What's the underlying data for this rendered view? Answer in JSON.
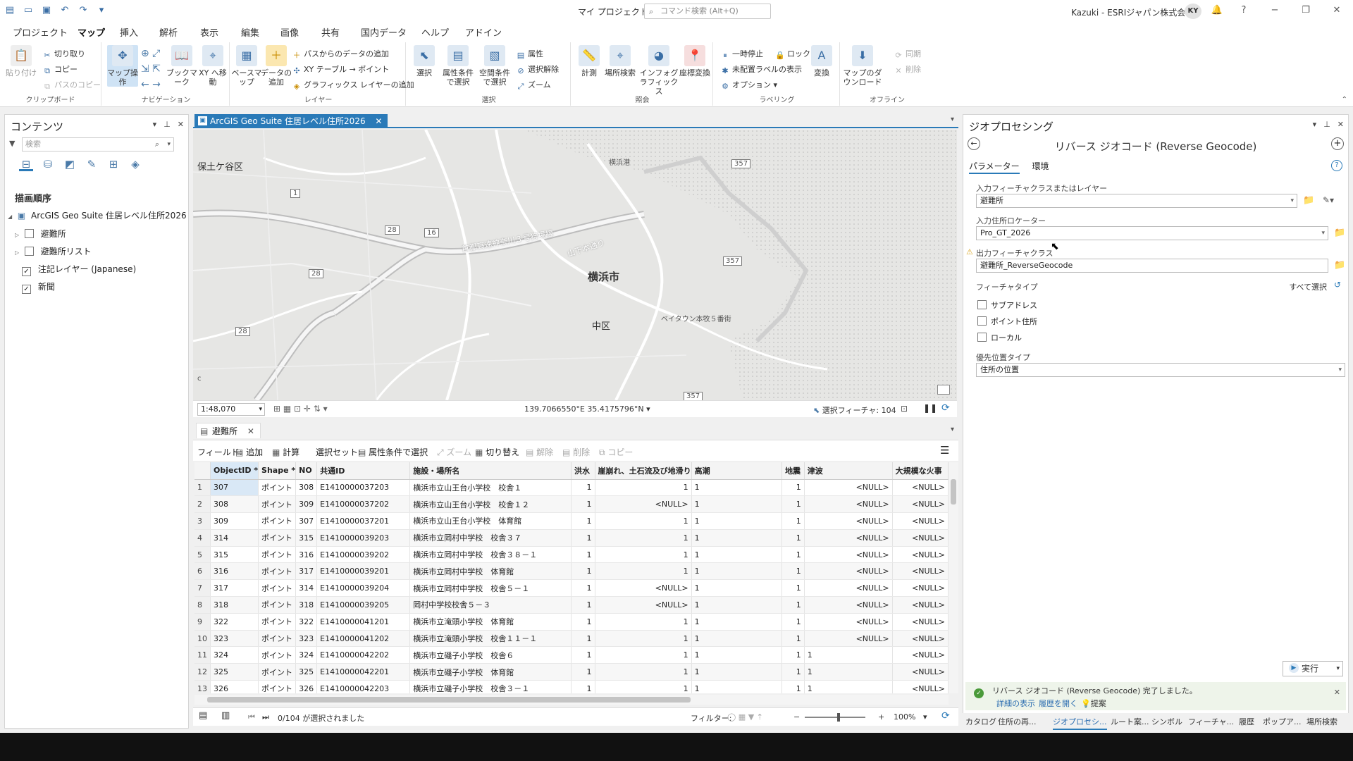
{
  "window": {
    "title": "マイ プロジェクト2",
    "command_search_placeholder": "コマンド検索 (Alt+Q)",
    "user": "Kazuki - ESRIジャパン株式会社",
    "avatar": "KY"
  },
  "ribbon_tabs": [
    "プロジェクト",
    "マップ",
    "挿入",
    "解析",
    "表示",
    "編集",
    "画像",
    "共有",
    "国内データ",
    "ヘルプ",
    "アドイン"
  ],
  "ribbon": {
    "clipboard": {
      "label": "クリップボード",
      "paste": "貼り付け",
      "cut": "切り取り",
      "copy": "コピー",
      "copy_path": "パスのコピー"
    },
    "navigation": {
      "label": "ナビゲーション",
      "explore": "マップ操作",
      "bookmarks": "ブックマーク",
      "xy": "XY へ移動"
    },
    "layer": {
      "label": "レイヤー",
      "basemap": "ベースマップ",
      "add_data": "データの追加",
      "add_from_path": "パスからのデータの追加",
      "xy_table": "XY テーブル → ポイント",
      "add_graphics": "グラフィックス レイヤーの追加"
    },
    "selection": {
      "label": "選択",
      "select": "選択",
      "by_attr": "属性条件で選択",
      "by_location": "空間条件で選択",
      "attributes": "属性",
      "clear": "選択解除",
      "zoom": "ズーム"
    },
    "inquiry": {
      "label": "照会",
      "measure": "計測",
      "locate": "場所検索",
      "infographics": "インフォグラフィックス",
      "convert_coords": "座標変換"
    },
    "labeling": {
      "label": "ラベリング",
      "pause": "一時停止",
      "lock": "ロック",
      "unplaced": "未配置ラベルの表示",
      "options": "オプション",
      "convert": "変換"
    },
    "offline": {
      "label": "オフライン",
      "download": "マップのダウンロード",
      "sync": "同期",
      "remove": "削除"
    }
  },
  "contents": {
    "title": "コンテンツ",
    "search_placeholder": "検索",
    "drawing_order": "描画順序",
    "map_name": "ArcGIS Geo Suite 住居レベル住所2026",
    "layers": [
      {
        "name": "避難所",
        "checked": false
      },
      {
        "name": "避難所リスト",
        "checked": false
      },
      {
        "name": "注記レイヤー (Japanese)",
        "checked": true
      },
      {
        "name": "新聞",
        "checked": true
      }
    ]
  },
  "map_view": {
    "tab_title": "ArcGIS Geo Suite 住居レベル住所2026",
    "labels": {
      "hodogaya": "保土ケ谷区",
      "yokohama_city": "横浜市",
      "naka": "中区",
      "baytown": "ベイタウン本牧５番街",
      "yamashita": "山下本通り",
      "expressway": "首都高速神奈川３号狩場線",
      "yokohama_port": "横浜港",
      "route_1": "1",
      "route_16": "16",
      "route_28a": "28",
      "route_28b": "28",
      "route_28c": "28",
      "route_357a": "357",
      "route_357b": "357",
      "route_357c": "357",
      "corner": "c"
    },
    "scale": "1:48,070",
    "coordinates": "139.7066550°E 35.4175796°N",
    "selected_features": "選択フィーチャ: 104"
  },
  "attribute_table": {
    "tab_title": "避難所",
    "toolbar": {
      "field": "フィールド:",
      "add": "追加",
      "calculate": "計算",
      "selection_set": "選択セット:",
      "select_by_attr": "属性条件で選択",
      "zoom": "ズーム",
      "switch": "切り替え",
      "clear": "解除",
      "delete": "削除",
      "copy": "コピー"
    },
    "columns": [
      "ObjectID *",
      "Shape *",
      "NO",
      "共通ID",
      "施設・場所名",
      "洪水",
      "崖崩れ、土石流及び地滑り",
      "高潮",
      "地震",
      "津波",
      "大規模な火事"
    ],
    "rows": [
      [
        "1",
        "307",
        "ポイント",
        "308",
        "E1410000037203",
        "横浜市立山王台小学校　校舎１",
        "1",
        "1",
        "1",
        "1",
        "<NULL>",
        "<NULL>"
      ],
      [
        "2",
        "308",
        "ポイント",
        "309",
        "E1410000037202",
        "横浜市立山王台小学校　校舎１２",
        "1",
        "<NULL>",
        "1",
        "1",
        "<NULL>",
        "<NULL>"
      ],
      [
        "3",
        "309",
        "ポイント",
        "307",
        "E1410000037201",
        "横浜市立山王台小学校　体育館",
        "1",
        "1",
        "1",
        "1",
        "<NULL>",
        "<NULL>"
      ],
      [
        "4",
        "314",
        "ポイント",
        "315",
        "E1410000039203",
        "横浜市立岡村中学校　校舎３７",
        "1",
        "1",
        "1",
        "1",
        "<NULL>",
        "<NULL>"
      ],
      [
        "5",
        "315",
        "ポイント",
        "316",
        "E1410000039202",
        "横浜市立岡村中学校　校舎３８－１",
        "1",
        "1",
        "1",
        "1",
        "<NULL>",
        "<NULL>"
      ],
      [
        "6",
        "316",
        "ポイント",
        "317",
        "E1410000039201",
        "横浜市立岡村中学校　体育館",
        "1",
        "1",
        "1",
        "1",
        "<NULL>",
        "<NULL>"
      ],
      [
        "7",
        "317",
        "ポイント",
        "314",
        "E1410000039204",
        "横浜市立岡村中学校　校舎５－１",
        "1",
        "<NULL>",
        "1",
        "1",
        "<NULL>",
        "<NULL>"
      ],
      [
        "8",
        "318",
        "ポイント",
        "318",
        "E1410000039205",
        "岡村中学校校舎５－３",
        "1",
        "<NULL>",
        "1",
        "1",
        "<NULL>",
        "<NULL>"
      ],
      [
        "9",
        "322",
        "ポイント",
        "322",
        "E1410000041201",
        "横浜市立滝頭小学校　体育館",
        "1",
        "1",
        "1",
        "1",
        "<NULL>",
        "<NULL>"
      ],
      [
        "10",
        "323",
        "ポイント",
        "323",
        "E1410000041202",
        "横浜市立滝頭小学校　校舎１１－１",
        "1",
        "1",
        "1",
        "1",
        "<NULL>",
        "<NULL>"
      ],
      [
        "11",
        "324",
        "ポイント",
        "324",
        "E1410000042202",
        "横浜市立磯子小学校　校舎６",
        "1",
        "1",
        "1",
        "1",
        "1",
        "<NULL>"
      ],
      [
        "12",
        "325",
        "ポイント",
        "325",
        "E1410000042201",
        "横浜市立磯子小学校　体育館",
        "1",
        "1",
        "1",
        "1",
        "1",
        "<NULL>"
      ],
      [
        "13",
        "326",
        "ポイント",
        "326",
        "E1410000042203",
        "横浜市立磯子小学校　校舎３－１",
        "1",
        "1",
        "1",
        "1",
        "1",
        "<NULL>"
      ]
    ],
    "status": "0/104 が選択されました",
    "filter_label": "フィルター:",
    "zoom_pct": "100%"
  },
  "geoprocessing": {
    "pane_title": "ジオプロセシング",
    "tool_title": "リバース ジオコード (Reverse Geocode)",
    "tabs": [
      "パラメーター",
      "環境"
    ],
    "input_features_label": "入力フィーチャクラスまたはレイヤー",
    "input_features_value": "避難所",
    "locator_label": "入力住所ロケーター",
    "locator_value": "Pro_GT_2026",
    "output_label": "出力フィーチャクラス",
    "output_value": "避難所_ReverseGeocode",
    "feature_type_label": "フィーチャタイプ",
    "select_all": "すべて選択",
    "feature_types": [
      "サブアドレス",
      "ポイント住所",
      "ローカル"
    ],
    "pref_loc_label": "優先位置タイプ",
    "pref_loc_value": "住所の位置",
    "run": "実行",
    "message": "リバース ジオコード (Reverse Geocode) 完了しました。",
    "link_details": "詳細の表示",
    "link_history": "履歴を開く",
    "link_suggest": "提案"
  },
  "bottom_tabs": [
    "カタログ",
    "住所の再...",
    "ジオプロセシ...",
    "ルート案...",
    "シンボル",
    "フィーチャ...",
    "履歴",
    "ポップア...",
    "場所検索"
  ]
}
